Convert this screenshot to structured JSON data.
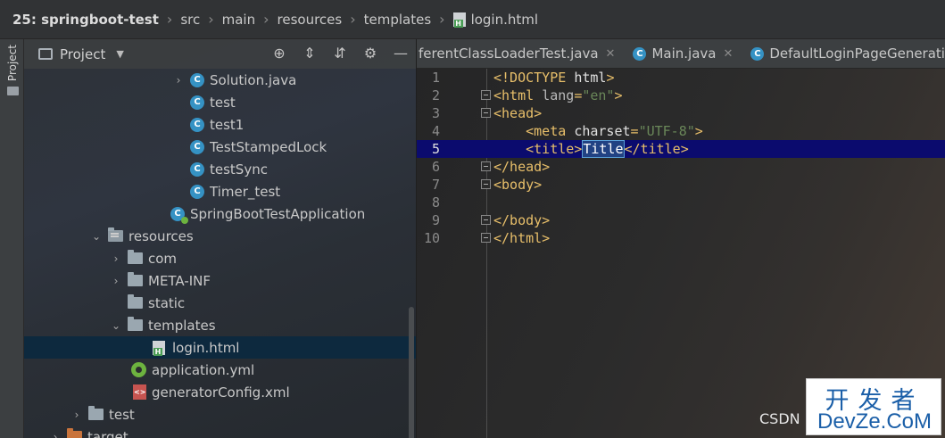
{
  "breadcrumb": {
    "items": [
      "25: springboot-test",
      "src",
      "main",
      "resources",
      "templates",
      "login.html"
    ]
  },
  "toolstrip": {
    "project_tab": "Project"
  },
  "project_panel": {
    "title": "Project",
    "tree": [
      {
        "label": "Solution.java",
        "kind": "class",
        "arrow": "right"
      },
      {
        "label": "test",
        "kind": "class"
      },
      {
        "label": "test1",
        "kind": "class"
      },
      {
        "label": "TestStampedLock",
        "kind": "class"
      },
      {
        "label": "testSync",
        "kind": "class"
      },
      {
        "label": "Timer_test",
        "kind": "class"
      },
      {
        "label": "SpringBootTestApplication",
        "kind": "spring-class"
      },
      {
        "label": "resources",
        "kind": "resources-folder",
        "arrow": "down"
      },
      {
        "label": "com",
        "kind": "folder",
        "arrow": "right"
      },
      {
        "label": "META-INF",
        "kind": "folder",
        "arrow": "right"
      },
      {
        "label": "static",
        "kind": "folder"
      },
      {
        "label": "templates",
        "kind": "folder",
        "arrow": "down"
      },
      {
        "label": "login.html",
        "kind": "html",
        "selected": true
      },
      {
        "label": "application.yml",
        "kind": "yml"
      },
      {
        "label": "generatorConfig.xml",
        "kind": "xml"
      },
      {
        "label": "test",
        "kind": "folder",
        "arrow": "right"
      },
      {
        "label": "target",
        "kind": "orange-folder",
        "arrow": "right"
      }
    ]
  },
  "editor_tabs": [
    {
      "label": "ferentClassLoaderTest.java"
    },
    {
      "label": "Main.java"
    },
    {
      "label": "DefaultLoginPageGeneratin"
    }
  ],
  "editor": {
    "current_line": 5,
    "lines": [
      {
        "n": "1",
        "segments": [
          [
            "tag",
            "<!DOCTYPE "
          ],
          [
            "plain",
            "html"
          ],
          [
            "tag",
            ">"
          ]
        ]
      },
      {
        "n": "2",
        "fold": true,
        "segments": [
          [
            "tag",
            "<html "
          ],
          [
            "attr",
            "lang"
          ],
          [
            "tag",
            "="
          ],
          [
            "str",
            "\"en\""
          ],
          [
            "tag",
            ">"
          ]
        ]
      },
      {
        "n": "3",
        "fold": true,
        "segments": [
          [
            "tag",
            "<head>"
          ]
        ]
      },
      {
        "n": "4",
        "segments": [
          [
            "plain",
            "    "
          ],
          [
            "tag",
            "<meta "
          ],
          [
            "plain",
            "charset"
          ],
          [
            "tag",
            "="
          ],
          [
            "str",
            "\"UTF-8\""
          ],
          [
            "tag",
            ">"
          ]
        ]
      },
      {
        "n": "5",
        "segments": [
          [
            "plain",
            "    "
          ],
          [
            "tag",
            "<title>"
          ],
          [
            "hl",
            "Title"
          ],
          [
            "tag",
            "</title>"
          ]
        ]
      },
      {
        "n": "6",
        "fold": true,
        "segments": [
          [
            "tag",
            "</head>"
          ]
        ]
      },
      {
        "n": "7",
        "fold": true,
        "segments": [
          [
            "tag",
            "<body>"
          ]
        ]
      },
      {
        "n": "8",
        "segments": []
      },
      {
        "n": "9",
        "fold": true,
        "segments": [
          [
            "tag",
            "</body>"
          ]
        ]
      },
      {
        "n": "10",
        "fold": true,
        "segments": [
          [
            "tag",
            "</html>"
          ]
        ]
      }
    ]
  },
  "watermark": {
    "csdn": "CSDN",
    "cn": "开发者",
    "en": "DevZe.CoM"
  },
  "icons": {
    "class": "class-c-icon",
    "folder": "folder-icon",
    "html": "html-file-icon",
    "yml": "spring-yml-icon",
    "xml": "xml-file-icon",
    "target": "gear-crosshair-icon"
  }
}
